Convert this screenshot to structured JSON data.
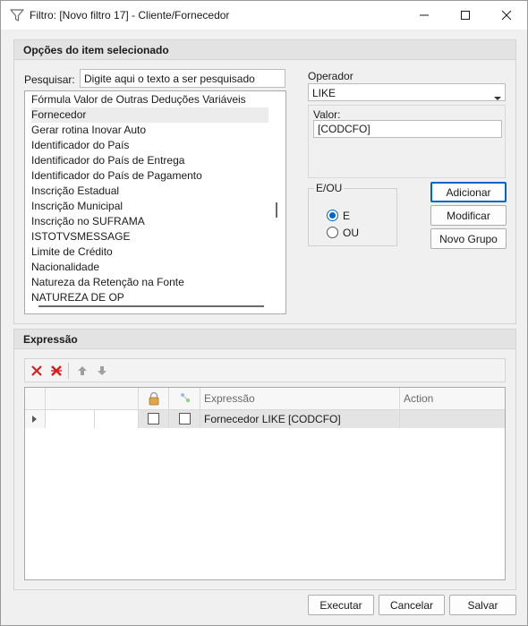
{
  "window": {
    "title": "Filtro: [Novo filtro 17] - Cliente/Fornecedor",
    "icon": "filter-icon"
  },
  "options_panel": {
    "header": "Opções do item selecionado",
    "search_label": "Pesquisar:",
    "search_value": "Digite aqui o texto a ser pesquisado",
    "fields": [
      "Fórmula Valor de Outras Deduções Variáveis",
      "Fornecedor",
      "Gerar rotina Inovar Auto",
      "Identificador do País",
      "Identificador do País de Entrega",
      "Identificador do País de Pagamento",
      "Inscrição Estadual",
      "Inscrição Municipal",
      "Inscrição no SUFRAMA",
      "ISTOTVSMESSAGE",
      "Limite de Crédito",
      "Nacionalidade",
      "Natureza da Retenção na Fonte",
      "NATUREZA DE OP"
    ],
    "selected_field": "Fornecedor",
    "operator_label": "Operador",
    "operator_value": "LIKE",
    "value_label": "Valor:",
    "value_value": "[CODCFO]",
    "eou_label": "E/OU",
    "radio_e": "E",
    "radio_ou": "OU",
    "radio_selected": "E",
    "btn_adicionar": "Adicionar",
    "btn_modificar": "Modificar",
    "btn_novo_grupo": "Novo Grupo"
  },
  "expression_panel": {
    "header": "Expressão",
    "toolbar_icons": [
      "delete-icon",
      "delete-all-icon",
      "arrow-up-icon",
      "arrow-down-icon"
    ],
    "columns": [
      "",
      "",
      "lock-icon",
      "link-icon",
      "Expressão",
      "Action"
    ],
    "rows": [
      {
        "expression": "Fornecedor LIKE [CODCFO]",
        "action": "",
        "locked": false,
        "linked": false
      }
    ]
  },
  "footer": {
    "btn_executar": "Executar",
    "btn_cancelar": "Cancelar",
    "btn_salvar": "Salvar"
  }
}
